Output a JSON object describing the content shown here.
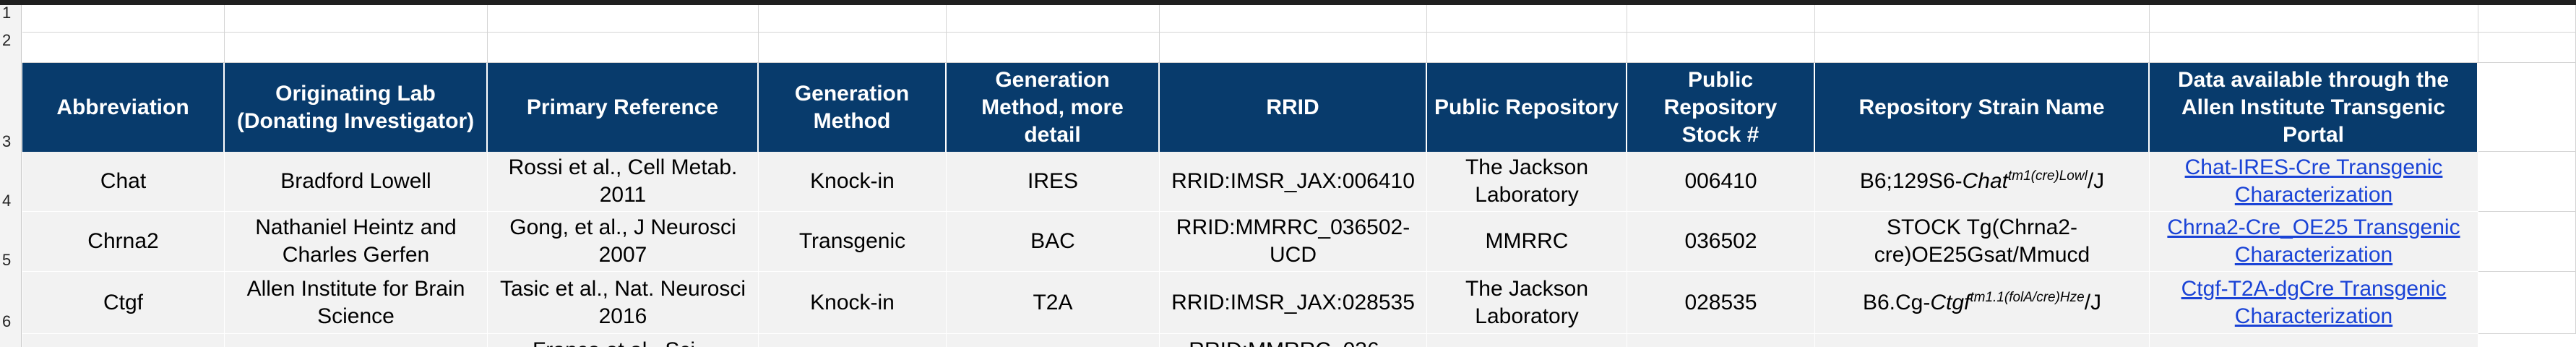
{
  "row_numbers": [
    "1",
    "2",
    "3",
    "4",
    "5",
    "6"
  ],
  "headers": [
    "Abbreviation",
    "Originating Lab (Donating Investigator)",
    "Primary Reference",
    "Generation Method",
    "Generation Method, more detail",
    "RRID",
    "Public Repository",
    "Public Repository Stock #",
    "Repository Strain Name",
    "Data available through the Allen Institute Transgenic Portal"
  ],
  "rows": [
    {
      "abbreviation": "Chat",
      "lab": "Bradford Lowell",
      "reference": "Rossi et al., Cell Metab. 2011",
      "method": "Knock-in",
      "method_detail": "IRES",
      "rrid": "RRID:IMSR_JAX:006410",
      "repository": "The Jackson Laboratory",
      "stock": "006410",
      "strain_prefix": "B6;129S6-",
      "strain_gene": "Chat",
      "strain_sup": "tm1(cre)Lowl",
      "strain_suffix": "/J",
      "portal_link": "Chat-IRES-Cre Transgenic Characterization"
    },
    {
      "abbreviation": "Chrna2",
      "lab": "Nathaniel Heintz and Charles Gerfen",
      "reference": "Gong, et al., J Neurosci 2007",
      "method": "Transgenic",
      "method_detail": "BAC",
      "rrid": "RRID:MMRRC_036502-UCD",
      "repository": "MMRRC",
      "stock": "036502",
      "strain_name": "STOCK Tg(Chrna2-cre)OE25Gsat/Mmucd",
      "portal_link": "Chrna2-Cre_OE25 Transgenic Characterization"
    },
    {
      "abbreviation": "Ctgf",
      "lab": "Allen Institute for Brain Science",
      "reference": "Tasic et al., Nat. Neurosci 2016",
      "method": "Knock-in",
      "method_detail": "T2A",
      "rrid": "RRID:IMSR_JAX:028535",
      "repository": "The Jackson Laboratory",
      "stock": "028535",
      "strain_prefix": "B6.Cg-",
      "strain_gene": "Ctgf",
      "strain_sup": "tm1.1(folA/cre)Hze",
      "strain_suffix": "/J",
      "portal_link": "Ctgf-T2A-dgCre Transgenic Characterization"
    }
  ],
  "partial_row": {
    "reference": "Franco et al., Sci...",
    "rrid": "RRID:MMRRC_036..."
  }
}
